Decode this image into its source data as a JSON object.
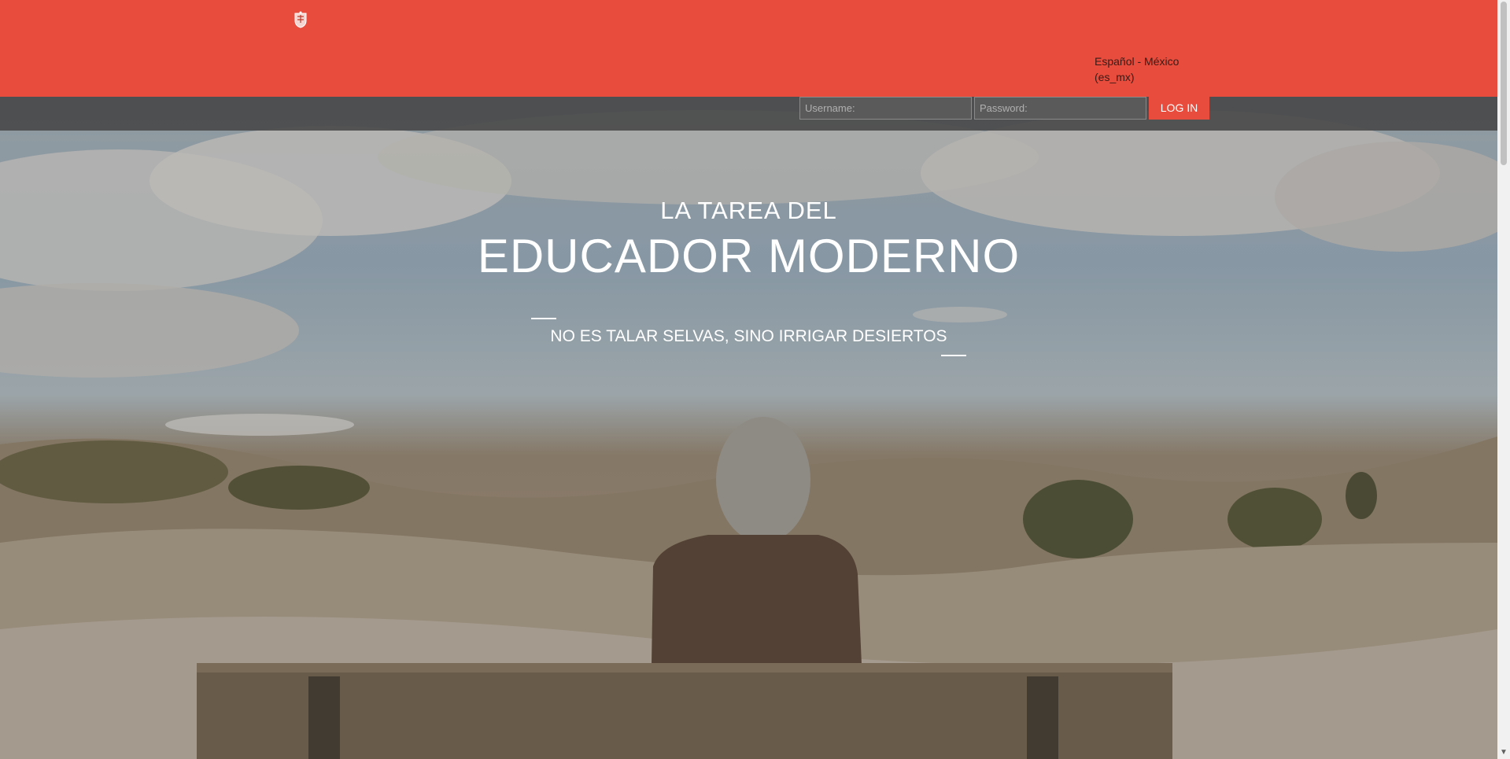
{
  "header": {
    "language": "Español - México (es_mx)"
  },
  "login": {
    "username_placeholder": "Username:",
    "password_placeholder": "Password:",
    "button_label": "LOG IN"
  },
  "hero": {
    "line1": "LA TAREA DEL",
    "line2": "EDUCADOR MODERNO",
    "subline": "NO ES TALAR SELVAS, SINO IRRIGAR DESIERTOS"
  },
  "colors": {
    "brand": "#e84c3d",
    "login_strip": "#464646"
  }
}
